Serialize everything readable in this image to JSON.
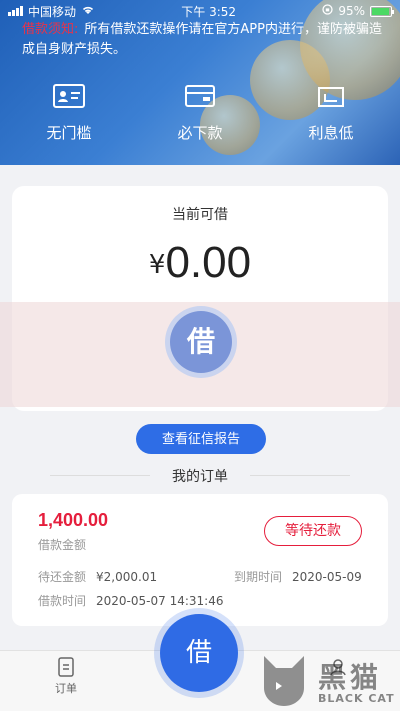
{
  "status_bar": {
    "carrier": "中国移动",
    "time": "下午 3:52",
    "battery": "95%",
    "battery_level": 0.95
  },
  "notice": {
    "tag": "借款须知:",
    "text": "所有借款还款操作请在官方APP内进行，谨防被骗造成自身财产损失。"
  },
  "features": [
    {
      "label": "无门槛",
      "icon": "id-card-icon"
    },
    {
      "label": "必下款",
      "icon": "wallet-icon"
    },
    {
      "label": "利息低",
      "icon": "receipt-icon"
    }
  ],
  "quota": {
    "label": "当前可借",
    "currency": "¥",
    "amount": "0.00"
  },
  "watermark": {
    "circle_char": "借"
  },
  "credit_report_button": "查看征信报告",
  "orders_title": "我的订单",
  "order": {
    "amount": "1,400.00",
    "amount_label": "借款金额",
    "status": "等待还款",
    "repay_label": "待还金额",
    "repay_value": "¥2,000.01",
    "due_label": "到期时间",
    "due_value": "2020-05-09",
    "loan_time_label": "借款时间",
    "loan_time_value": "2020-05-07 14:31:46"
  },
  "tabbar": {
    "orders_label": "订单",
    "borrow_label": "借"
  },
  "logo": {
    "cn": "黑猫",
    "en": "BLACK CAT"
  },
  "colors": {
    "primary": "#2e6de6",
    "danger": "#e51e3c"
  }
}
